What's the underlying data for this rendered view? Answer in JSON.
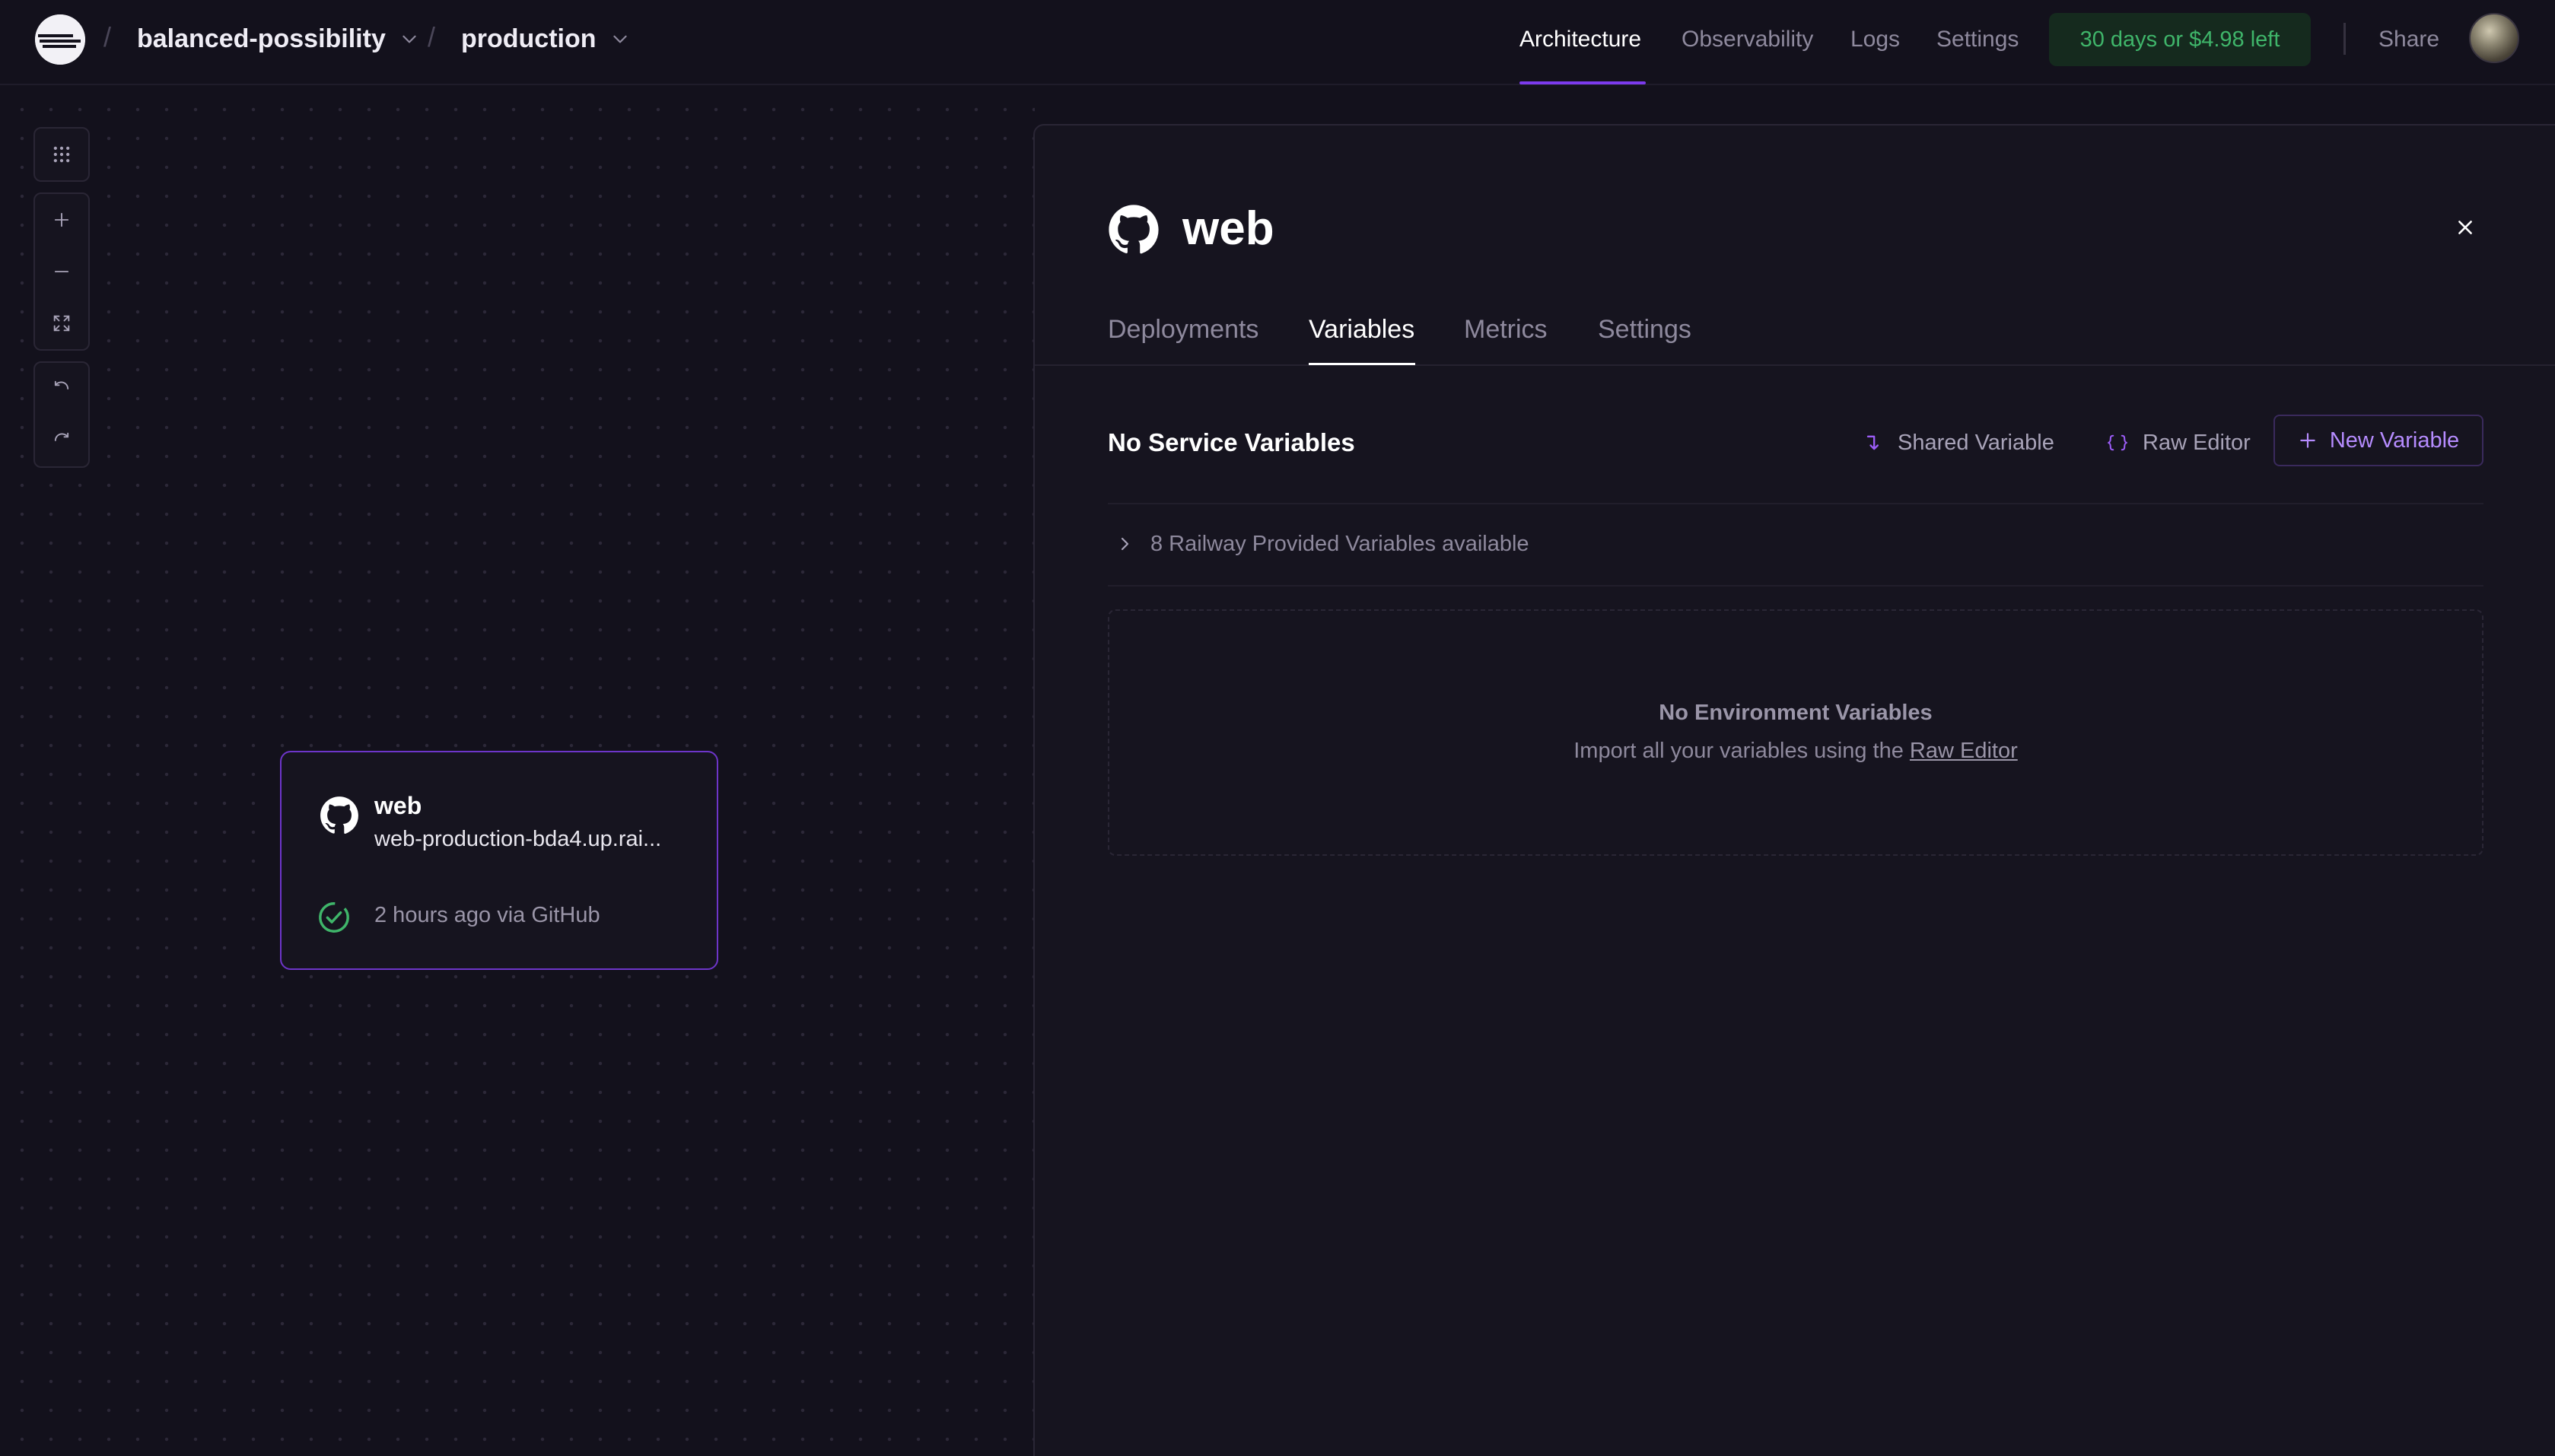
{
  "header": {
    "project_name": "balanced-possibility",
    "environment": "production",
    "nav": {
      "architecture": "Architecture",
      "observability": "Observability",
      "logs": "Logs",
      "settings": "Settings"
    },
    "trial": "30 days or $4.98 left",
    "share": "Share"
  },
  "canvas": {
    "service_card": {
      "name": "web",
      "url": "web-production-bda4.up.rai...",
      "status": "2 hours ago via GitHub"
    }
  },
  "panel": {
    "title": "web",
    "tabs": {
      "deployments": "Deployments",
      "variables": "Variables",
      "metrics": "Metrics",
      "settings": "Settings"
    },
    "active_tab": "Variables",
    "heading": "No Service Variables",
    "actions": {
      "shared": "Shared Variable",
      "raw": "Raw Editor",
      "new": "New Variable"
    },
    "provided": "8 Railway Provided Variables available",
    "empty": {
      "title": "No Environment Variables",
      "subtitle_prefix": "Import all your variables using the ",
      "subtitle_link": "Raw Editor"
    }
  },
  "colors": {
    "background": "#13111c",
    "panel": "#16141f",
    "accent": "#7c3aed",
    "accent_text": "#b68cff",
    "success": "#3fb56a",
    "trial_bg": "#152a1e"
  },
  "icons": [
    "railway-logo-icon",
    "chevron-down-icon",
    "grid-icon",
    "zoom-in-icon",
    "zoom-out-icon",
    "fit-view-icon",
    "undo-icon",
    "redo-icon",
    "github-icon",
    "check-circle-icon",
    "close-icon",
    "shared-variable-icon",
    "braces-icon",
    "plus-icon",
    "chevron-right-icon"
  ]
}
